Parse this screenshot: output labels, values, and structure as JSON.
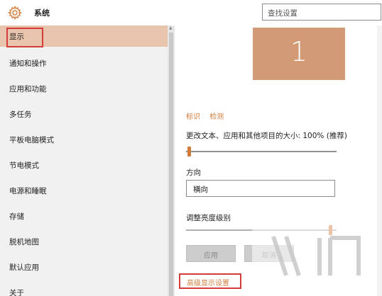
{
  "window": {
    "title": "系统",
    "icon": "gear-icon"
  },
  "search": {
    "placeholder": "查找设置"
  },
  "sidebar": {
    "items": [
      {
        "label": "显示",
        "selected": true
      },
      {
        "label": "通知和操作"
      },
      {
        "label": "应用和功能"
      },
      {
        "label": "多任务"
      },
      {
        "label": "平板电脑模式"
      },
      {
        "label": "节电模式"
      },
      {
        "label": "电源和睡眠"
      },
      {
        "label": "存储"
      },
      {
        "label": "脱机地图"
      },
      {
        "label": "默认应用"
      },
      {
        "label": "关于"
      }
    ]
  },
  "display": {
    "monitor_number": "1",
    "links": {
      "identify": "标识",
      "detect": "检测"
    },
    "scale_label": "更改文本、应用和其他项目的大小: 100% (推荐)",
    "scale_value_fraction": 0.0,
    "orientation_label": "方向",
    "orientation_value": "横向",
    "brightness_label": "调整亮度级别",
    "brightness_value_fraction": 0.97,
    "apply_label": "应用",
    "cancel_label": "取消",
    "advanced_link": "高级显示设置"
  },
  "colors": {
    "accent": "#d27c3c",
    "selected_bg": "#e8c4ac",
    "monitor": "#d29b76",
    "highlight_box": "#d43c3c"
  }
}
